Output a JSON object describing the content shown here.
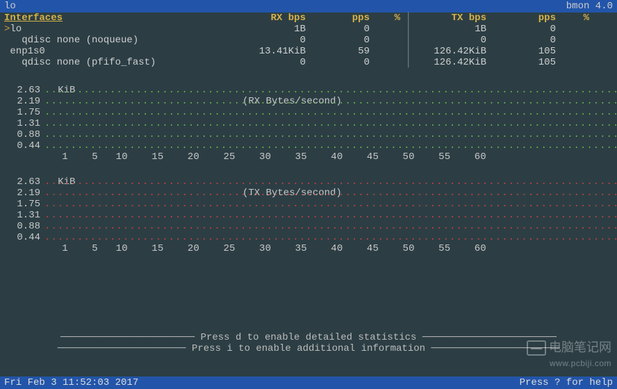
{
  "titlebar": {
    "left": "lo",
    "right": "bmon 4.0"
  },
  "table": {
    "headers": {
      "interfaces": "Interfaces",
      "rx_bps": "RX bps",
      "pps1": "pps",
      "pct1": "%",
      "sep": "│",
      "tx_bps": "TX bps",
      "pps2": "pps",
      "pct2": "%"
    },
    "rows": [
      {
        "cursor": ">",
        "label": "lo",
        "rx_bps": "1B",
        "pps1": "0",
        "pct1": "",
        "tx_bps": "1B",
        "pps2": "0",
        "pct2": ""
      },
      {
        "cursor": " ",
        "label": "  qdisc none (noqueue)",
        "rx_bps": "0",
        "pps1": "0",
        "pct1": "",
        "tx_bps": "0",
        "pps2": "0",
        "pct2": ""
      },
      {
        "cursor": " ",
        "label": "enp1s0",
        "rx_bps": "13.41KiB",
        "pps1": "59",
        "pct1": "",
        "tx_bps": "126.42KiB",
        "pps2": "105",
        "pct2": ""
      },
      {
        "cursor": " ",
        "label": "  qdisc none (pfifo_fast)",
        "rx_bps": "0",
        "pps1": "0",
        "pct1": "",
        "tx_bps": "126.42KiB",
        "pps2": "105",
        "pct2": ""
      }
    ]
  },
  "chart_data": [
    {
      "type": "line",
      "title": "(RX Bytes/second)",
      "unit": "KiB",
      "ylabels": [
        "2.63",
        "2.19",
        "1.75",
        "1.31",
        "0.88",
        "0.44"
      ],
      "xlabels": [
        "1",
        "5",
        "10",
        "15",
        "20",
        "25",
        "30",
        "35",
        "40",
        "45",
        "50",
        "55",
        "60"
      ],
      "color": "green"
    },
    {
      "type": "line",
      "title": "(TX Bytes/second)",
      "unit": "KiB",
      "ylabels": [
        "2.63",
        "2.19",
        "1.75",
        "1.31",
        "0.88",
        "0.44"
      ],
      "xlabels": [
        "1",
        "5",
        "10",
        "15",
        "20",
        "25",
        "30",
        "35",
        "40",
        "45",
        "50",
        "55",
        "60"
      ],
      "color": "red"
    }
  ],
  "hints": {
    "line1": "─────────────────────── Press d to enable detailed statistics ───────────────────────",
    "line2": "────────────────────── Press i to enable additional information ──────────────────────"
  },
  "footer": {
    "left": "Fri Feb  3 11:52:03 2017",
    "right": "Press ? for help"
  },
  "watermark": {
    "main": "电脑笔记网",
    "sub": "www.pcbiji.com"
  },
  "dotline": "..............................................................................................."
}
